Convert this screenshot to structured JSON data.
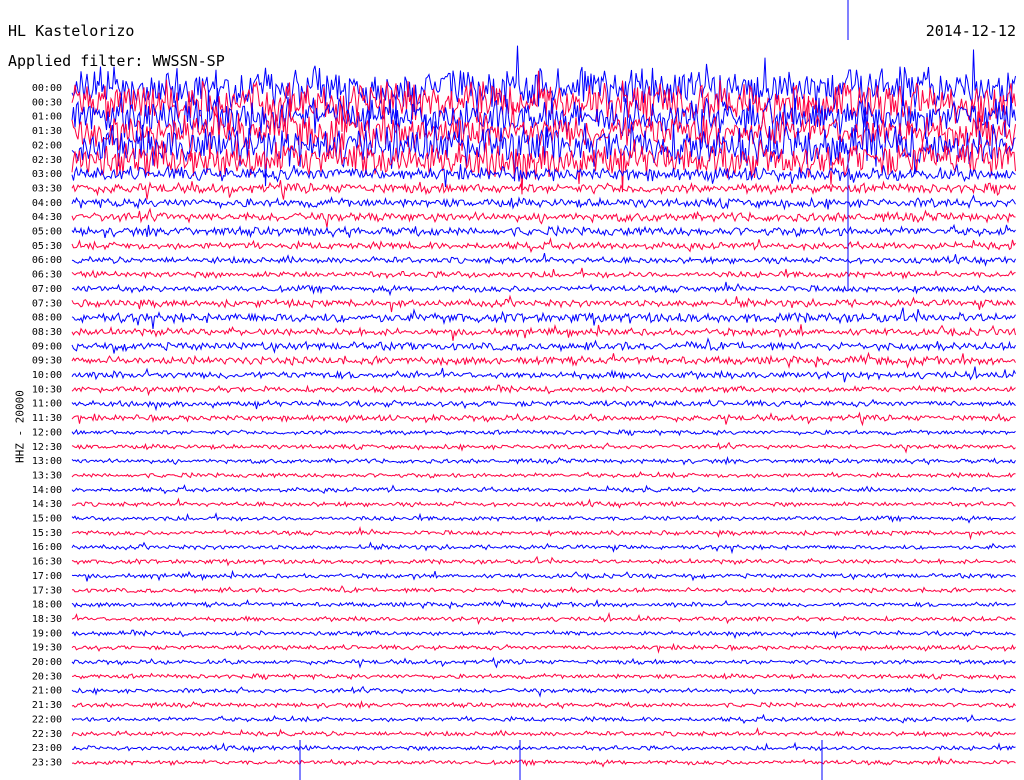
{
  "header": {
    "station": "HL Kastelorizo",
    "date": "2014-12-12",
    "filter": "Applied filter: WWSSN-SP"
  },
  "chart_data": {
    "type": "line",
    "title": "HL Kastelorizo",
    "channel_label": "HHZ - 20000",
    "ylabel": "HHZ - 20000",
    "xlabel": "",
    "y_ticks": [
      "00:00",
      "00:30",
      "01:00",
      "01:30",
      "02:00",
      "02:30",
      "03:00",
      "03:30",
      "04:00",
      "04:30",
      "05:00",
      "05:30",
      "06:00",
      "06:30",
      "07:00",
      "07:30",
      "08:00",
      "08:30",
      "09:00",
      "09:30",
      "10:00",
      "10:30",
      "11:00",
      "11:30",
      "12:00",
      "12:30",
      "13:00",
      "13:30",
      "14:00",
      "14:30",
      "15:00",
      "15:30",
      "16:00",
      "16:30",
      "17:00",
      "17:30",
      "18:00",
      "18:30",
      "19:00",
      "19:30",
      "20:00",
      "20:30",
      "21:00",
      "21:30",
      "22:00",
      "22:30",
      "23:00",
      "23:30"
    ],
    "series": [
      {
        "name": "",
        "color": "#0000ff"
      },
      {
        "name": "",
        "color": "#ff0040"
      }
    ],
    "trace_minutes": 30,
    "trace_amplitude": [
      9,
      9,
      8,
      8,
      9,
      8,
      3,
      2.2,
      2,
      2,
      2,
      1.6,
      1.4,
      1.4,
      1.4,
      1.6,
      2.2,
      1.6,
      1.8,
      1.8,
      1.6,
      1.3,
      1.3,
      1.3,
      1,
      1,
      1,
      1,
      1,
      1,
      1,
      1,
      1,
      1,
      1,
      1,
      1,
      1,
      1,
      1,
      1,
      1,
      1,
      1,
      1,
      1,
      1,
      1
    ],
    "grid": false,
    "legend": "none"
  }
}
